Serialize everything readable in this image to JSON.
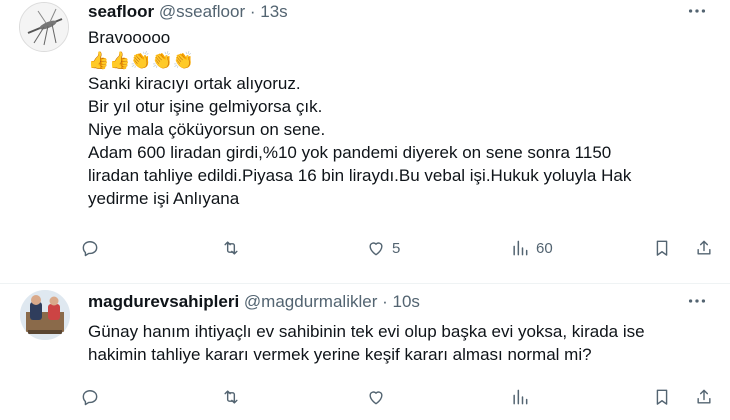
{
  "tweets": [
    {
      "name": "seafloor",
      "handle": "@sseafloor",
      "dot": "·",
      "time": "13s",
      "more_icon": "more-horizontal-icon",
      "body_lines": [
        "Bravooooo",
        "👍👍👏👏👏",
        "Sanki kiracıyı ortak alıyoruz.",
        "Bir yıl otur işine gelmiyorsa çık.",
        "Niye mala çöküyorsun on sene.",
        "Adam 600 liradan girdi,%10  yok pandemi diyerek on sene sonra 1150",
        "liradan tahliye edildi.Piyasa 16 bin liraydı.Bu vebal işi.Hukuk yoluyla Hak",
        "yedirme işi Anlıyana"
      ],
      "like_count": "5",
      "view_count": "60"
    },
    {
      "name": "magdurevsahipleri",
      "handle": "@magdurmalikler",
      "dot": "·",
      "time": "10s",
      "more_icon": "more-horizontal-icon",
      "body_lines": [
        "Günay hanım ihtiyaçlı ev sahibinin tek evi olup başka evi yoksa, kirada ise",
        "hakimin tahliye kararı vermek yerine keşif kararı alması normal mi?"
      ],
      "like_count": "",
      "view_count": ""
    }
  ],
  "colors": {
    "text": "#0f1419",
    "muted": "#536471",
    "divider": "#eff3f4"
  }
}
